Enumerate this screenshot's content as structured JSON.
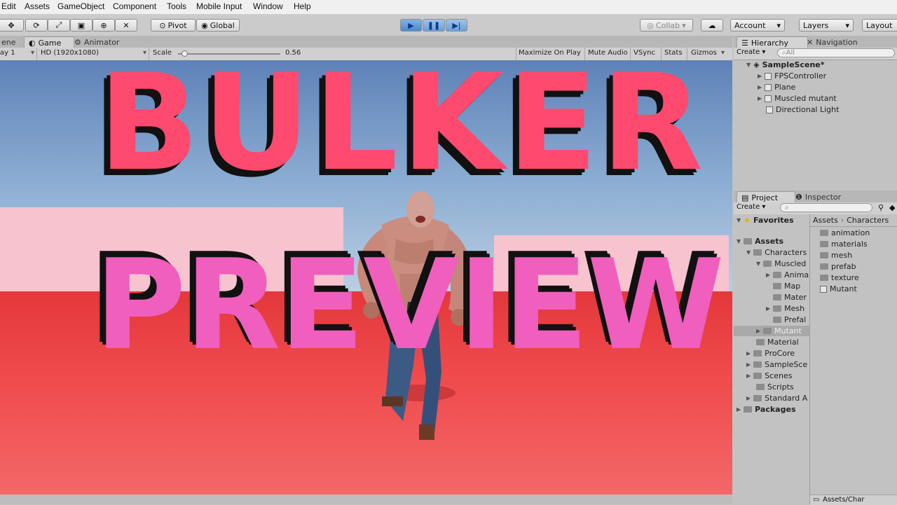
{
  "menu": [
    "Edit",
    "Assets",
    "GameObject",
    "Component",
    "Tools",
    "Mobile Input",
    "Window",
    "Help"
  ],
  "toolbar": {
    "pivot": "Pivot",
    "global": "Global",
    "collab": "Collab",
    "account": "Account",
    "layers": "Layers",
    "layout": "Layout"
  },
  "game_tabs": {
    "scene": "ene",
    "game": "Game",
    "animator": "Animator"
  },
  "game_bar": {
    "display": "ay 1",
    "resolution": "HD (1920x1080)",
    "scale_label": "Scale",
    "scale_value": "0.56",
    "scale_fraction": 0.06,
    "maximize": "Maximize On Play",
    "mute": "Mute Audio",
    "vsync": "VSync",
    "stats": "Stats",
    "gizmos": "Gizmos"
  },
  "overlay": {
    "line1": "BULKER",
    "line2": "PREVIEW"
  },
  "hierarchy": {
    "tab": "Hierarchy",
    "tab2": "Navigation",
    "create": "Create",
    "search": "All",
    "scene": "SampleScene*",
    "items": [
      "FPSController",
      "Plane",
      "Muscled mutant",
      "Directional Light"
    ]
  },
  "project": {
    "tab": "Project",
    "tab2": "Inspector",
    "create": "Create",
    "favorites": "Favorites",
    "assets": "Assets",
    "tree": [
      "Characters",
      "Muscled",
      "Anima",
      "Map",
      "Mater",
      "Mesh",
      "Prefal",
      "Mutant",
      "Material",
      "ProCore",
      "SampleSce",
      "Scenes",
      "Scripts",
      "Standard A"
    ],
    "packages": "Packages",
    "breadcrumb": [
      "Assets",
      "Characters"
    ],
    "files": [
      "animation",
      "materials",
      "mesh",
      "prefab",
      "texture",
      "Mutant"
    ],
    "status_path": "Assets/Char"
  },
  "colors": {
    "play_accent": "#4d89c8",
    "floor": "#f04a4c",
    "overlay_top": "#ff3f6c",
    "overlay_bottom": "#ee5fb8"
  }
}
